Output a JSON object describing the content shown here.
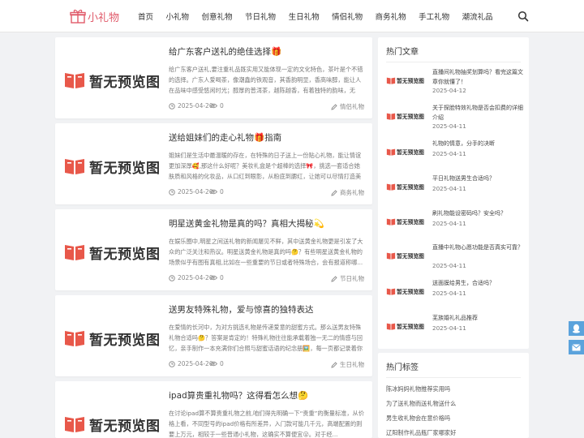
{
  "site": {
    "logo_text": "小礼物",
    "accent": "#e05a6a"
  },
  "nav": [
    "首页",
    "小礼物",
    "创意礼物",
    "节日礼物",
    "生日礼物",
    "情侣礼物",
    "商务礼物",
    "手工礼物",
    "潮流礼品"
  ],
  "placeholder_text": "暂无预览图",
  "articles": [
    {
      "title": "给广东客户送礼的绝佳选择🎁",
      "excerpt": "给广东客户送礼,要注重礼品既实用又能体现一定的文化特色，茶叶是个不错的选择。广东人爱喝茶，像潮鑫的铁观音，其香韵明显，香高味醇，能让人在品味中感受悠闲时光；醇厚的普洱茶，越陈越香，有着独特的韵味，无论...",
      "date": "2025-04-20",
      "views": "0",
      "category": "情侣礼物"
    },
    {
      "title": "送给姐妹们的走心礼物🎁指南",
      "excerpt": "姐妹们是生活中最温暖的存在，在特殊的日子送上一份贴心礼物，能让情谊更加深厚🥰,那这什么好呢？美妆礼盒是个超棒的选择🎀，挑选一套适合她肤质和风格的化妆品，从口红到眼影，从粉底到腮红，让她可以尽情打造美丽...",
      "date": "2025-04-20",
      "views": "0",
      "category": "商务礼物"
    },
    {
      "title": "明星送黄金礼物是真的吗？真相大揭秘💫",
      "excerpt": "在娱乐圈中,明星之间送礼物的新闻屡见不鲜，其中送黄金礼物更是引发了大众的广泛关注和热议。明星送黄金礼物是真的吗🤔？有些明星送黄金礼物的场景似乎有图有真相,比如在一些重要的节日或者特殊场合，会有报道称哪...",
      "date": "2025-04-20",
      "views": "0",
      "category": "节日礼物"
    },
    {
      "title": "送男友特殊礼物，爱与惊喜的独特表达",
      "excerpt": "在爱情的长河中，为对方挑选礼物是传递爱意的甜蜜方式。那么送男友特殊礼物合适吗🤔？答案是肯定的！特殊礼物往往能承载着独一无二的情感与回忆，亲手制作一本充满你们合照与甜蜜话语的纪念册🖼️，每一页都记录着你们...",
      "date": "2025-04-20",
      "views": "0",
      "category": "生日礼物"
    },
    {
      "title": "ipad算贵重礼物吗？这得看怎么想🤔",
      "excerpt": "在讨论ipad算不算贵重礼物之前,咱们得先明确一下“贵重”的衡量标准，从价格上看，不同型号的ipad价格有所差异，入门款可能几千元，高端配置的则要上万元，相较于一些普通小礼物，这确实不算便宜😮。对于经...",
      "date": "",
      "views": "",
      "category": ""
    }
  ],
  "hot": {
    "title": "热门文章",
    "items": [
      {
        "title": "直播间礼物抽奖划算吗？看完这篇文章你就懂了！",
        "date": "2025-04-12"
      },
      {
        "title": "关于探脸特效礼物是否会扣费的详细介绍",
        "date": "2025-04-11"
      },
      {
        "title": "礼物的情意，分手的决断",
        "date": "2025-04-11"
      },
      {
        "title": "平日礼物送男生合适吗？",
        "date": "2025-04-11"
      },
      {
        "title": "刷礼物能设密码吗？安全吗？",
        "date": "2025-04-11"
      },
      {
        "title": "直播中礼物心愿功能是否真实可靠？",
        "date": "2025-04-11"
      },
      {
        "title": "送面膜给男生，合适吗？",
        "date": "2025-04-11"
      },
      {
        "title": "芜族婚礼礼品推荐",
        "date": "2025-04-11"
      }
    ]
  },
  "tags": {
    "title": "热门标签",
    "items": [
      "陈冰妈妈礼物推荐实用吗",
      "为了送礼物而送礼物送什么",
      "男生收礼物会在意价格吗",
      "辽阳制作礼品瓶厂家哪家好"
    ]
  }
}
